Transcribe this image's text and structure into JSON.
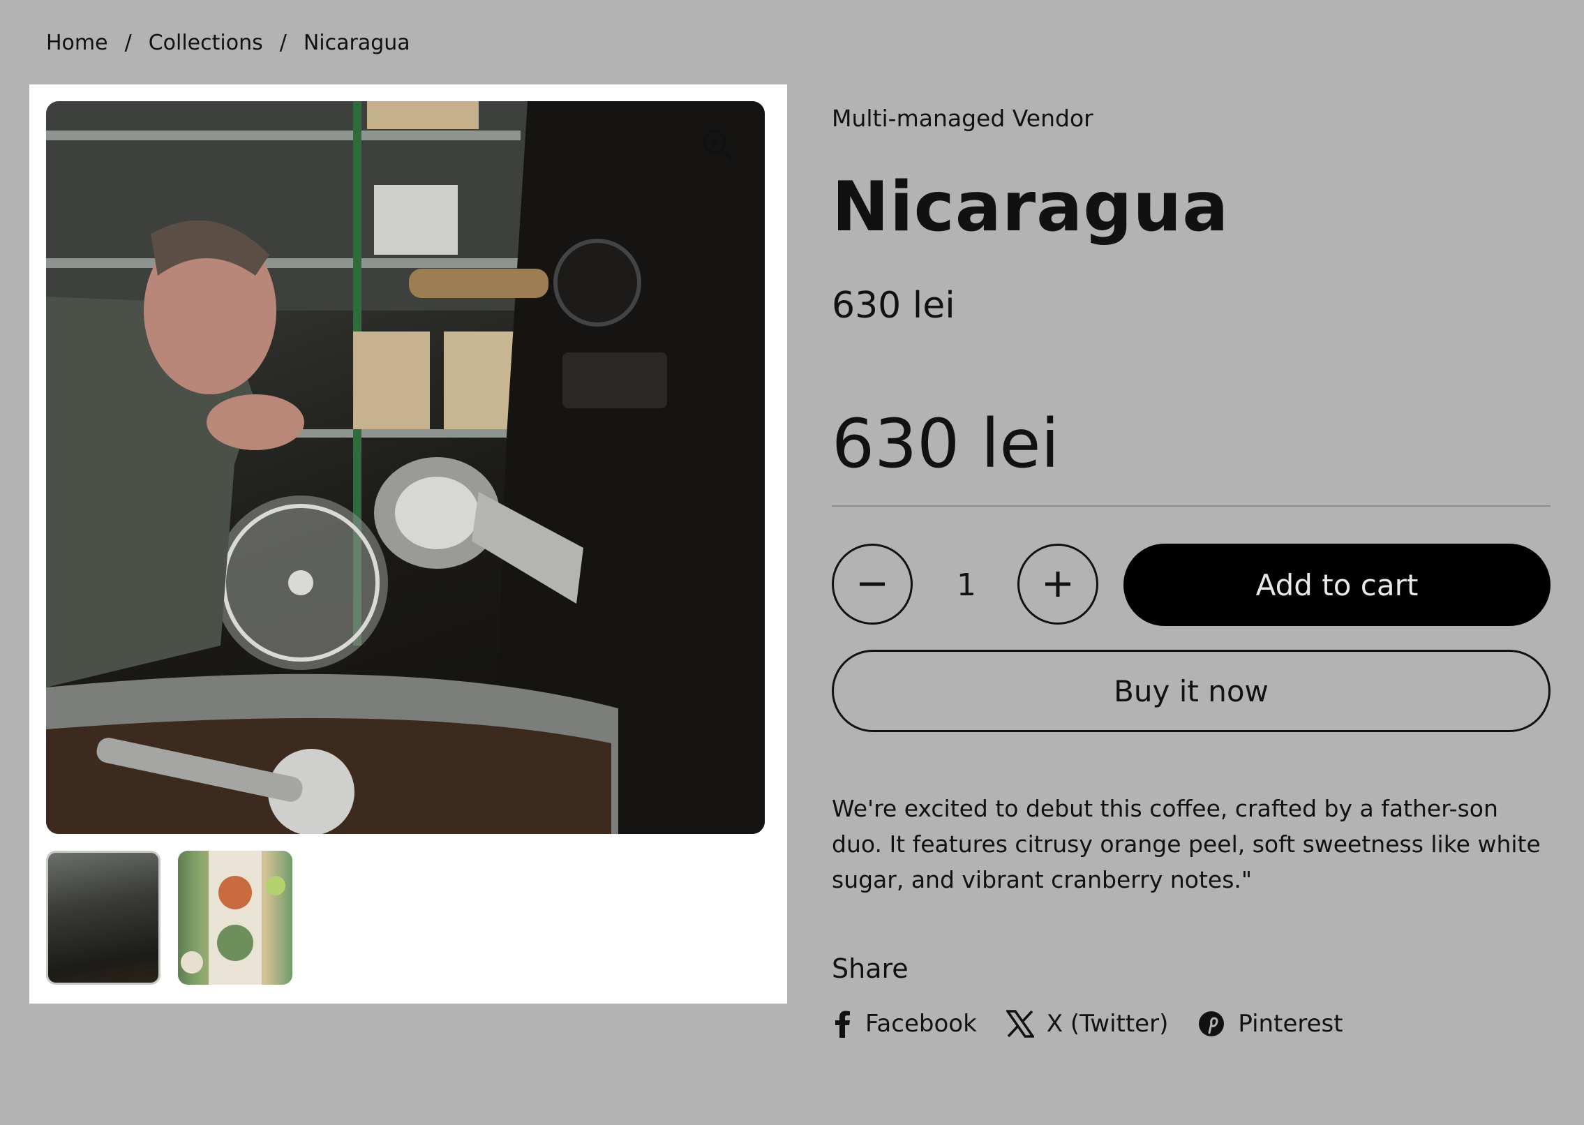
{
  "breadcrumb": {
    "items": [
      "Home",
      "Collections",
      "Nicaragua"
    ],
    "separator": "/"
  },
  "gallery": {
    "thumbnails": [
      "roaster-thumbnail",
      "food-spread-thumbnail"
    ]
  },
  "product": {
    "vendor": "Multi-managed Vendor",
    "title": "Nicaragua",
    "price": "630 lei",
    "price_large": "630 lei",
    "quantity": "1",
    "add_to_cart_label": "Add to cart",
    "buy_now_label": "Buy it now",
    "description": "We're excited to debut this coffee, crafted by a father-son duo. It features citrusy orange peel, soft sweetness like white sugar, and vibrant cranberry notes.\""
  },
  "share": {
    "title": "Share",
    "links": [
      {
        "label": "Facebook",
        "icon": "facebook-icon"
      },
      {
        "label": "X (Twitter)",
        "icon": "x-twitter-icon"
      },
      {
        "label": "Pinterest",
        "icon": "pinterest-icon"
      }
    ]
  },
  "colors": {
    "page_background": "#b3b3b3",
    "primary_button": "#000000",
    "text": "#111111"
  }
}
